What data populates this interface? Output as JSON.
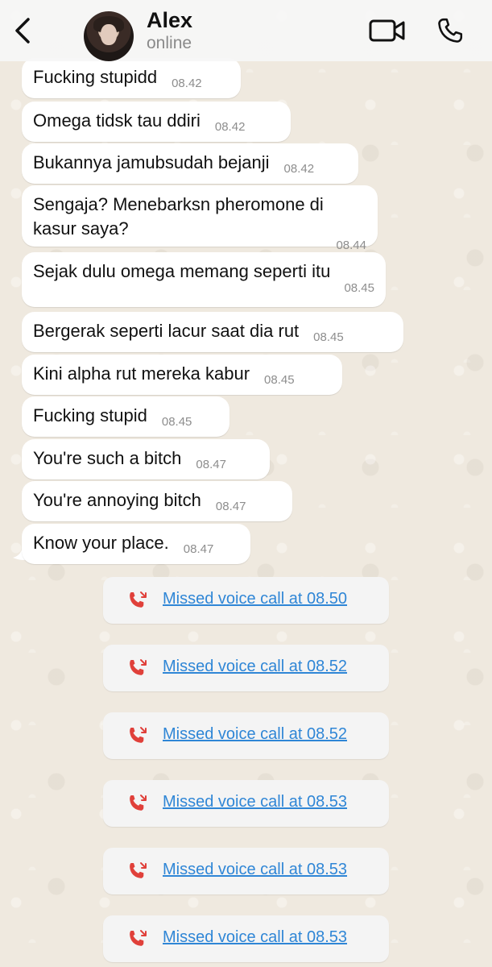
{
  "contact": {
    "name": "Alex",
    "status": "online"
  },
  "messages": [
    {
      "text": "Fucking stupidd",
      "time": "08.42"
    },
    {
      "text": "Omega tidsk tau ddiri",
      "time": "08.42"
    },
    {
      "text": "Bukannya jamubsudah bejanji",
      "time": "08.42"
    },
    {
      "text": "Sengaja? Menebarksn pheromone di kasur saya?",
      "time": "08.44"
    },
    {
      "text": "Sejak dulu omega memang seperti itu",
      "time": "08.45"
    },
    {
      "text": "Bergerak seperti lacur saat dia rut",
      "time": "08.45"
    },
    {
      "text": "Kini alpha rut mereka kabur",
      "time": "08.45"
    },
    {
      "text": "Fucking stupid",
      "time": "08.45"
    },
    {
      "text": "You're such a bitch",
      "time": "08.47"
    },
    {
      "text": "You're annoying bitch",
      "time": "08.47"
    },
    {
      "text": "Know your place.",
      "time": "08.47"
    }
  ],
  "missed_calls": [
    {
      "label": "Missed voice call at 08.50"
    },
    {
      "label": "Missed voice call at 08.52"
    },
    {
      "label": "Missed voice call at 08.52"
    },
    {
      "label": "Missed voice call at 08.53"
    },
    {
      "label": "Missed voice call at 08.53"
    },
    {
      "label": "Missed voice call at 08.53"
    }
  ],
  "icons": {
    "back": "chevron-left-icon",
    "video": "video-camera-icon",
    "phone": "phone-icon",
    "missed_call": "missed-call-icon"
  },
  "colors": {
    "missed_call_icon": "#e0403a",
    "missed_call_link": "#2f86d6",
    "wallpaper": "#efe9df"
  }
}
